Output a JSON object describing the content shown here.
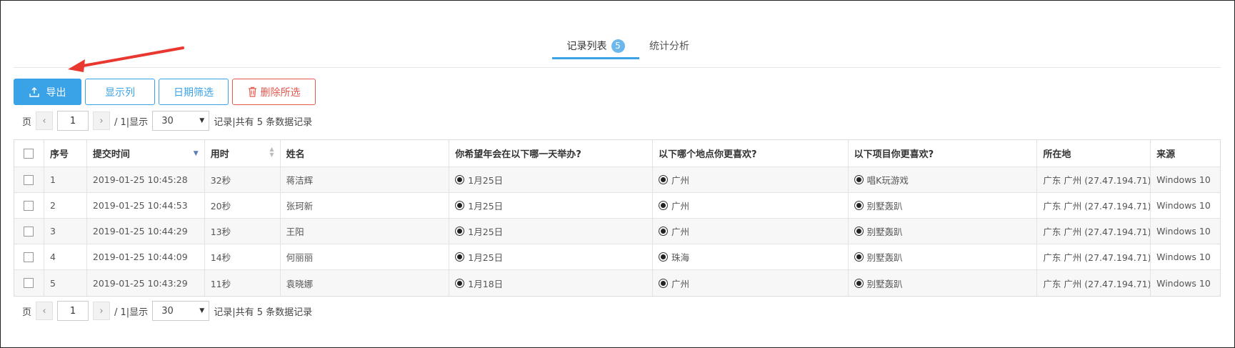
{
  "tabs": [
    {
      "label": "记录列表",
      "badge": "5"
    },
    {
      "label": "统计分析"
    }
  ],
  "toolbar": {
    "export_label": "导出",
    "columns_label": "显示列",
    "date_filter_label": "日期筛选",
    "delete_label": "删除所选"
  },
  "pager": {
    "page_prefix": "页",
    "current_page": "1",
    "total_text": "/ 1|显示",
    "page_size": "30",
    "summary": "记录|共有 5 条数据记录"
  },
  "table": {
    "headers": [
      "序号",
      "提交时间",
      "用时",
      "姓名",
      "你希望年会在以下哪一天举办?",
      "以下哪个地点你更喜欢?",
      "以下项目你更喜欢?",
      "所在地",
      "来源"
    ],
    "rows": [
      {
        "no": "1",
        "time": "2019-01-25 10:45:28",
        "dur": "32秒",
        "name": "蒋洁辉",
        "q1": "1月25日",
        "q2": "广州",
        "q3": "唱K玩游戏",
        "loc": "广东 广州 (27.47.194.71)",
        "src": "Windows 10"
      },
      {
        "no": "2",
        "time": "2019-01-25 10:44:53",
        "dur": "20秒",
        "name": "张珂新",
        "q1": "1月25日",
        "q2": "广州",
        "q3": "别墅轰趴",
        "loc": "广东 广州 (27.47.194.71)",
        "src": "Windows 10"
      },
      {
        "no": "3",
        "time": "2019-01-25 10:44:29",
        "dur": "13秒",
        "name": "王阳",
        "q1": "1月25日",
        "q2": "广州",
        "q3": "别墅轰趴",
        "loc": "广东 广州 (27.47.194.71)",
        "src": "Windows 10"
      },
      {
        "no": "4",
        "time": "2019-01-25 10:44:09",
        "dur": "14秒",
        "name": "何丽丽",
        "q1": "1月25日",
        "q2": "珠海",
        "q3": "别墅轰趴",
        "loc": "广东 广州 (27.47.194.71)",
        "src": "Windows 10"
      },
      {
        "no": "5",
        "time": "2019-01-25 10:43:29",
        "dur": "11秒",
        "name": "袁晓娜",
        "q1": "1月18日",
        "q2": "广州",
        "q3": "别墅轰趴",
        "loc": "广东 广州 (27.47.194.71)",
        "src": "Windows 10"
      }
    ]
  },
  "colors": {
    "primary": "#3aa3e8",
    "danger": "#e55a4f",
    "annotation_arrow": "#e8382f"
  },
  "icons": [
    "upload-icon",
    "trash-icon",
    "chevron-left-icon",
    "chevron-right-icon",
    "caret-down-icon",
    "sort-icon"
  ]
}
